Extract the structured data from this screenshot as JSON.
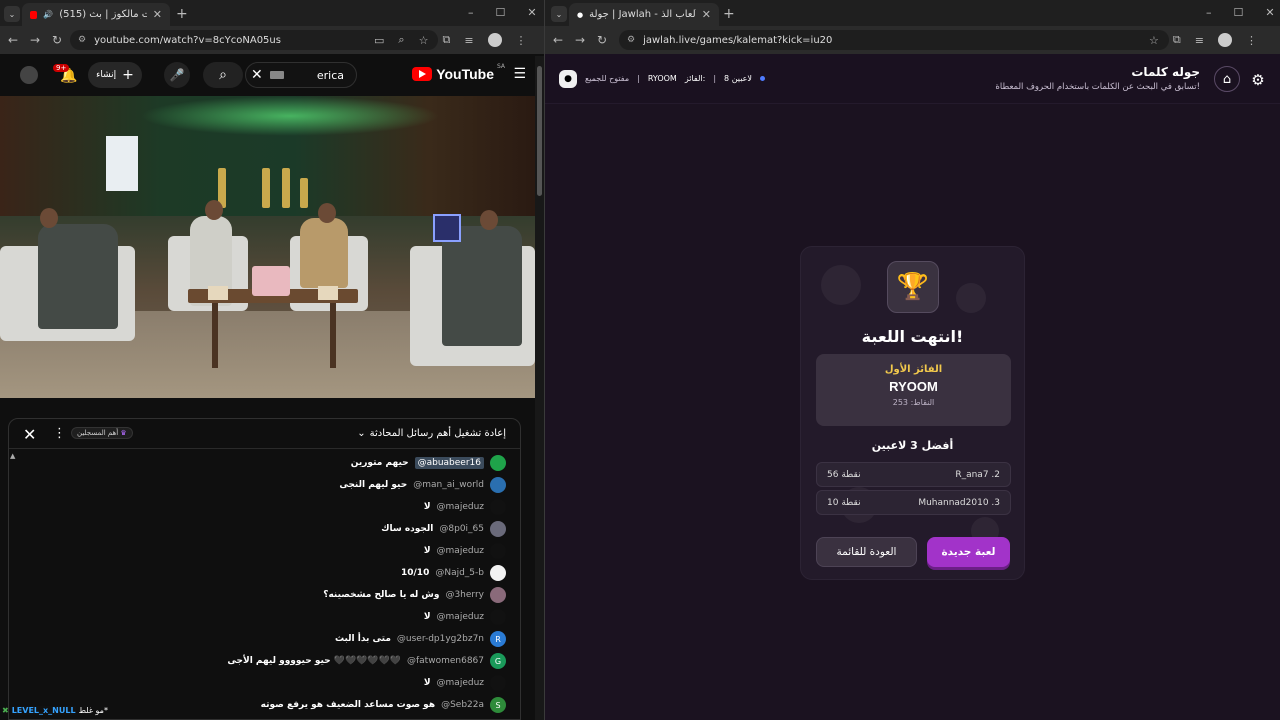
{
  "left_browser": {
    "tab_title": "(515) بودكاست مالكوز | بث",
    "url": "youtube.com/watch?v=8cYcoNA05us"
  },
  "youtube": {
    "logo_text": "YouTube",
    "region": "SA",
    "search_value": "erica",
    "create_label": "إنشاء",
    "notif_count": "9+",
    "chat_title": "إعادة تشغيل أهم رسائل المحادثة",
    "members_tag": "أهم المسجلين",
    "messages": [
      {
        "author": "@abuabeer16",
        "text": "حيهم متورين",
        "avatar_color": "#1fa34a",
        "highlight": true
      },
      {
        "author": "@man_ai_world",
        "text": "حيو ليهم النجى",
        "avatar_color": "#2a6fb0",
        "highlight": false
      },
      {
        "author": "@majeduz",
        "text": "لا",
        "avatar_color": "#111111",
        "highlight": false
      },
      {
        "author": "@8p0i_65",
        "text": "الجوده ساك",
        "avatar_color": "#6a6a7a",
        "highlight": false
      },
      {
        "author": "@majeduz",
        "text": "لا",
        "avatar_color": "#111111",
        "highlight": false
      },
      {
        "author": "@Najd_5-b",
        "text": "10/10",
        "avatar_color": "#f2f2f2",
        "highlight": false
      },
      {
        "author": "@3herry",
        "text": "وش له يا صالح مشخصينه؟",
        "avatar_color": "#8a6a7a",
        "highlight": false
      },
      {
        "author": "@majeduz",
        "text": "لا",
        "avatar_color": "#111111",
        "highlight": false
      },
      {
        "author": "@user-dp1yg2bz7n",
        "text": "متى بدأ البث",
        "avatar_color": "#2a7bd4",
        "avatar_letter": "R",
        "highlight": false
      },
      {
        "author": "@fatwomen6867",
        "text": "حيو حيوووو ليهم الأجى 🖤🖤🖤🖤🖤🖤",
        "avatar_color": "#1a9a5a",
        "avatar_letter": "G",
        "highlight": false
      },
      {
        "author": "@majeduz",
        "text": "لا",
        "avatar_color": "#111111",
        "highlight": false
      },
      {
        "author": "@Seb22a",
        "text": "هو صوت مساعد الضعيف هو يرفع صوته",
        "avatar_color": "#2e8b3a",
        "avatar_letter": "S",
        "highlight": false
      }
    ],
    "bottom_note_user": "LEVEL_x_NULL",
    "bottom_note_text": "مو غلط*"
  },
  "right_browser": {
    "tab_title": "جولة | Jawlah - منصة الألعاب الذ",
    "url": "jawlah.live/games/kalemat?kick=iu20"
  },
  "jawlah": {
    "game_title": "جوله كلمات",
    "game_subtitle": "تسابق في البحث عن الكلمات باستخدام الحروف المعطاة!",
    "players_count": "8 لاعبين",
    "winner_meta_label": "الفائز:",
    "winner_meta_name": "RYOOM",
    "open_label": "مفتوح للجميع",
    "card": {
      "game_over": "انتهت اللعبة!",
      "first_label": "الفائز الأول",
      "winner_name": "RYOOM",
      "winner_points": "النقاط: 253",
      "top3_title": "أفضل 3 لاعبين",
      "players": [
        {
          "rank_name": "R_ana7 .2",
          "points": "56 نقطة"
        },
        {
          "rank_name": "Muhannad2010 .3",
          "points": "10 نقطة"
        }
      ],
      "new_game": "لعبة جديدة",
      "back_list": "العودة للقائمة"
    }
  }
}
